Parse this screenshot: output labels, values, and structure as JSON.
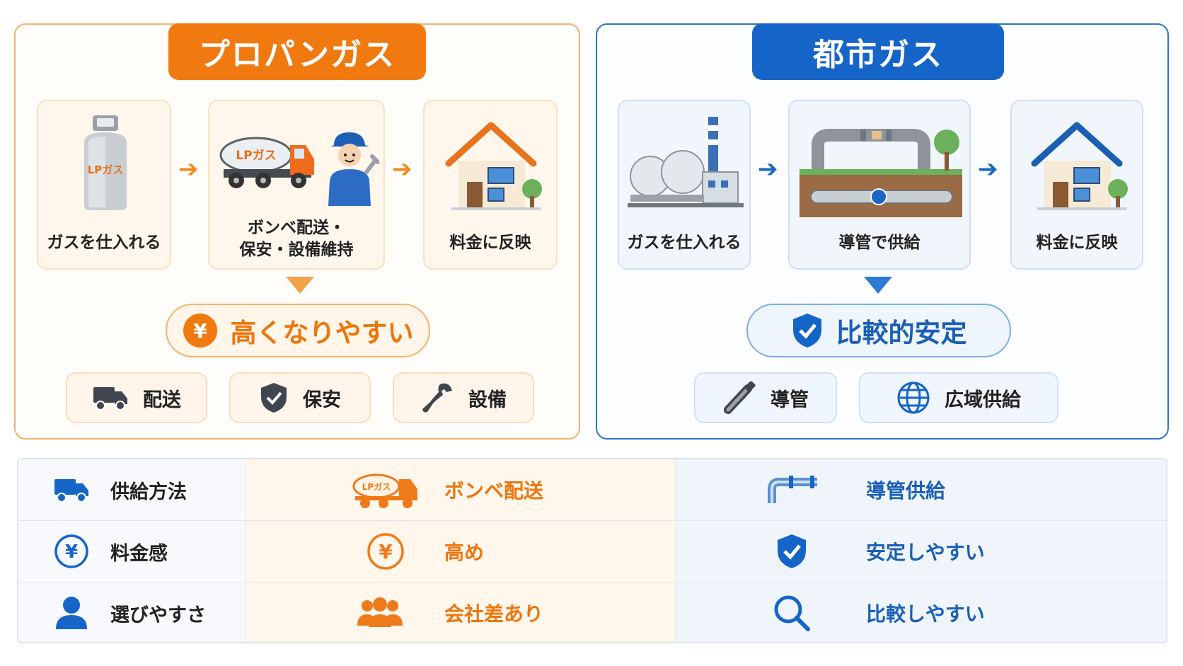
{
  "propane": {
    "title": "プロパンガス",
    "steps": [
      {
        "label": "ガスを仕入れる",
        "tank_label": "LPガス"
      },
      {
        "label_line1": "ボンベ配送・",
        "label_line2": "保安・設備維持",
        "truck_label": "LPガス"
      },
      {
        "label": "料金に反映"
      }
    ],
    "result": {
      "icon": "yen-icon",
      "text": "高くなりやすい"
    },
    "factors": [
      {
        "icon": "truck-icon",
        "label": "配送"
      },
      {
        "icon": "shield-check-icon",
        "label": "保安"
      },
      {
        "icon": "wrench-icon",
        "label": "設備"
      }
    ],
    "colors": {
      "accent": "#f07a10",
      "border": "#f5b26b"
    }
  },
  "city": {
    "title": "都市ガス",
    "steps": [
      {
        "label": "ガスを仕入れる"
      },
      {
        "label": "導管で供給"
      },
      {
        "label": "料金に反映"
      }
    ],
    "result": {
      "icon": "shield-check-icon",
      "text": "比較的安定"
    },
    "factors": [
      {
        "icon": "pipe-icon",
        "label": "導管"
      },
      {
        "icon": "globe-icon",
        "label": "広域供給"
      }
    ],
    "colors": {
      "accent": "#1565c8",
      "border": "#2f74c8"
    }
  },
  "comparison": {
    "rows": [
      {
        "icon": "truck-icon",
        "label": "供給方法",
        "propane": {
          "icon": "lp-truck-icon",
          "truck_label": "LPガス",
          "text": "ボンベ配送"
        },
        "city": {
          "icon": "pipe-icon",
          "text": "導管供給"
        }
      },
      {
        "icon": "yen-icon",
        "label": "料金感",
        "propane": {
          "icon": "yen-icon",
          "text": "高め"
        },
        "city": {
          "icon": "shield-check-icon",
          "text": "安定しやすい"
        }
      },
      {
        "icon": "person-icon",
        "label": "選びやすさ",
        "propane": {
          "icon": "people-icon",
          "text": "会社差あり"
        },
        "city": {
          "icon": "search-icon",
          "text": "比較しやすい"
        }
      }
    ]
  }
}
